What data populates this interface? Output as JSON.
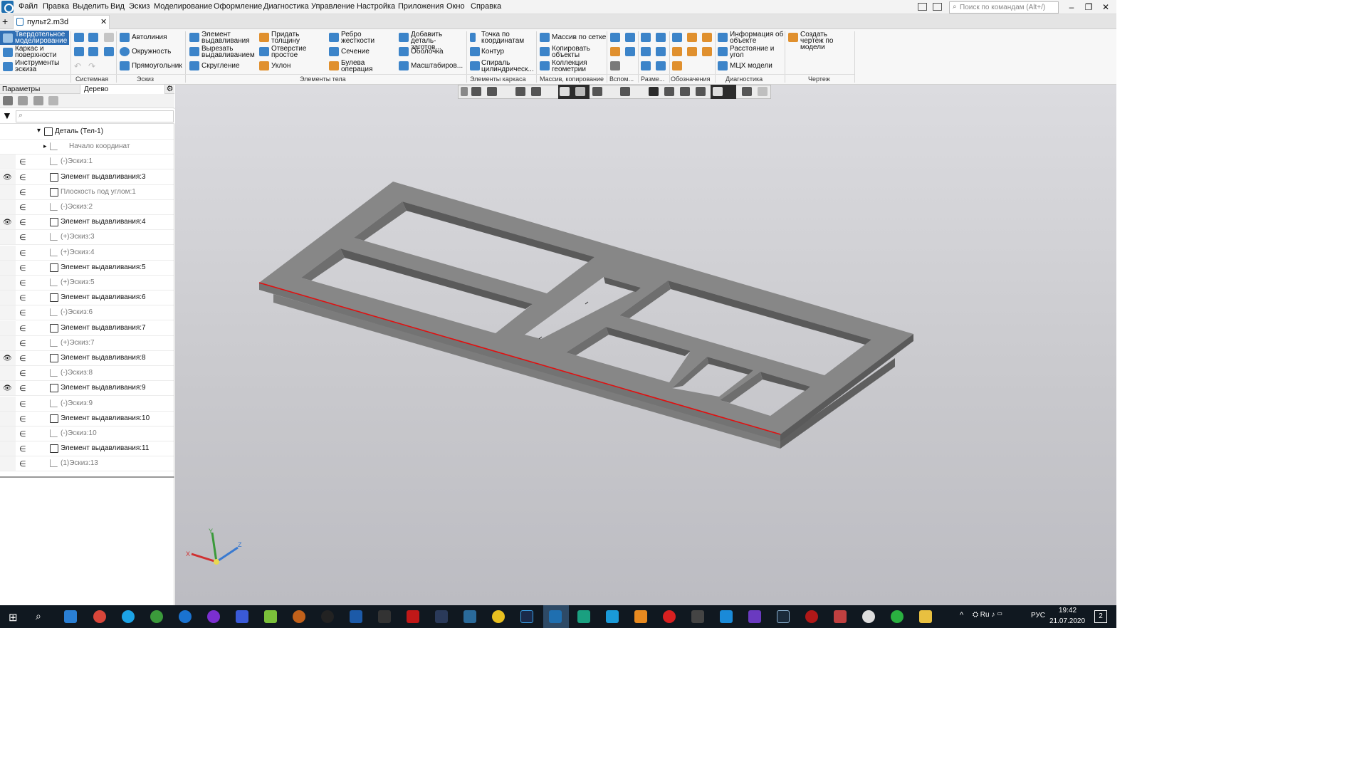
{
  "menu": [
    "Файл",
    "Правка",
    "Выделить",
    "Вид",
    "Эскиз",
    "Моделирование",
    "Оформление",
    "Диагностика",
    "Управление",
    "Настройка",
    "Приложения",
    "Окно",
    "Справка"
  ],
  "command_search_placeholder": "Поиск по командам (Alt+/)",
  "document_tab": "пульт2.m3d",
  "ribbon": {
    "left_modes": [
      "Твердотельное моделирование",
      "Каркас и поверхности",
      "Инструменты эскиза"
    ],
    "sketch": [
      "Автолиния",
      "Окружность",
      "Прямоугольник"
    ],
    "body_elements": [
      "Элемент выдавливания",
      "Вырезать выдавливанием",
      "Скругление",
      "Придать толщину",
      "Отверстие простое",
      "Уклон",
      "Ребро жесткости",
      "Сечение",
      "Булева операция",
      "Добавить деталь-заготов...",
      "Оболочка",
      "Масштабиров..."
    ],
    "frame_elements": [
      "Точка по координатам",
      "Контур",
      "Спираль цилиндрическ..."
    ],
    "array": [
      "Массив по сетке",
      "Копировать объекты",
      "Коллекция геометрии"
    ],
    "diagnostics": [
      "Информация об объекте",
      "Расстояние и угол",
      "МЦХ модели"
    ],
    "drawing": [
      "Создать чертеж по модели"
    ],
    "group_labels": [
      "Системная",
      "Эскиз",
      "Элементы тела",
      "Элементы каркаса",
      "Массив, копирование",
      "Вспом...",
      "Разме...",
      "Обозначения",
      "Диагностика",
      "Чертеж"
    ]
  },
  "panel_tabs": [
    "Параметры",
    "Дерево"
  ],
  "filter_placeholder": "",
  "tree": [
    {
      "label": "Деталь (Тел-1)",
      "type": "part",
      "visible": false
    },
    {
      "label": "Начало координат",
      "type": "origin",
      "visible": false
    },
    {
      "label": "(-)Эскиз:1",
      "type": "sketch",
      "visible": false
    },
    {
      "label": "Элемент выдавливания:3",
      "type": "feature",
      "visible": true
    },
    {
      "label": "Плоскость под углом:1",
      "type": "plane",
      "visible": false
    },
    {
      "label": "(-)Эскиз:2",
      "type": "sketch",
      "visible": false
    },
    {
      "label": "Элемент выдавливания:4",
      "type": "feature",
      "visible": true
    },
    {
      "label": "(+)Эскиз:3",
      "type": "sketch",
      "visible": false
    },
    {
      "label": "(+)Эскиз:4",
      "type": "sketch",
      "visible": false
    },
    {
      "label": "Элемент выдавливания:5",
      "type": "feature",
      "visible": false
    },
    {
      "label": "(+)Эскиз:5",
      "type": "sketch",
      "visible": false
    },
    {
      "label": "Элемент выдавливания:6",
      "type": "feature",
      "visible": false
    },
    {
      "label": "(-)Эскиз:6",
      "type": "sketch",
      "visible": false
    },
    {
      "label": "Элемент выдавливания:7",
      "type": "feature",
      "visible": false
    },
    {
      "label": "(+)Эскиз:7",
      "type": "sketch",
      "visible": false
    },
    {
      "label": "Элемент выдавливания:8",
      "type": "feature",
      "visible": true
    },
    {
      "label": "(-)Эскиз:8",
      "type": "sketch",
      "visible": false
    },
    {
      "label": "Элемент выдавливания:9",
      "type": "feature",
      "visible": true
    },
    {
      "label": "(-)Эскиз:9",
      "type": "sketch",
      "visible": false
    },
    {
      "label": "Элемент выдавливания:10",
      "type": "feature",
      "visible": false
    },
    {
      "label": "(-)Эскиз:10",
      "type": "sketch",
      "visible": false
    },
    {
      "label": "Элемент выдавливания:11",
      "type": "feature",
      "visible": false
    },
    {
      "label": "(1)Эскиз:13",
      "type": "sketch",
      "visible": false
    }
  ],
  "axes": {
    "x": "X",
    "y": "Y",
    "z": "Z"
  },
  "tray": {
    "lang": "РУС",
    "time": "19:42",
    "date": "21.07.2020",
    "notifications": "2"
  }
}
